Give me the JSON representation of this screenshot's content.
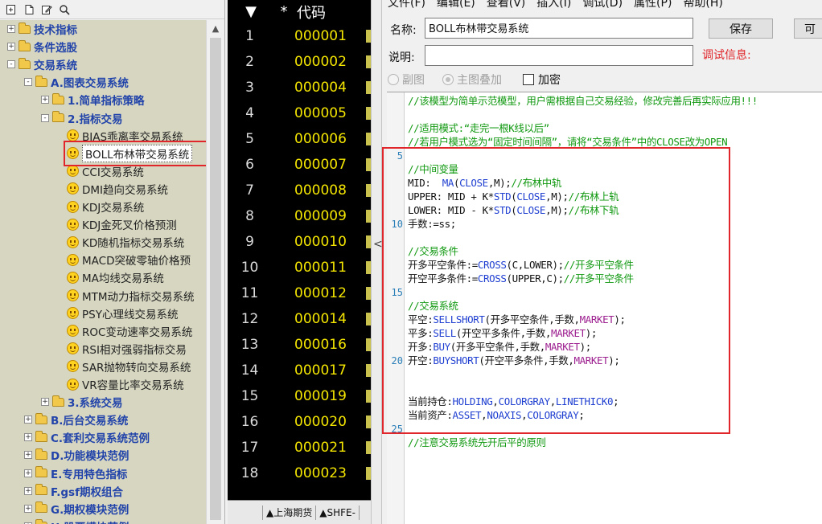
{
  "left_toolbar": {
    "icons": [
      "new-item-icon",
      "copy-icon",
      "edit-icon",
      "search-icon"
    ]
  },
  "tree": {
    "nodes": [
      {
        "label": "技术指标",
        "kind": "folder",
        "expander": "+"
      },
      {
        "label": "条件选股",
        "kind": "folder",
        "expander": "+"
      },
      {
        "label": "交易系统",
        "kind": "folder",
        "expander": "-"
      },
      {
        "label": "A.图表交易系统",
        "kind": "folder",
        "expander": "-"
      },
      {
        "label": "1.简单指标策略",
        "kind": "folder",
        "expander": "+"
      },
      {
        "label": "2.指标交易",
        "kind": "folder",
        "expander": "-"
      },
      {
        "label": "BIAS乖离率交易系统",
        "kind": "leaf"
      },
      {
        "label": "BOLL布林带交易系统",
        "kind": "leaf",
        "selected": true
      },
      {
        "label": "CCI交易系统",
        "kind": "leaf"
      },
      {
        "label": "DMI趋向交易系统",
        "kind": "leaf"
      },
      {
        "label": "KDJ交易系统",
        "kind": "leaf"
      },
      {
        "label": "KDJ金死叉价格预测",
        "kind": "leaf"
      },
      {
        "label": "KD随机指标交易系统",
        "kind": "leaf"
      },
      {
        "label": "MACD突破零轴价格预",
        "kind": "leaf"
      },
      {
        "label": "MA均线交易系统",
        "kind": "leaf"
      },
      {
        "label": "MTM动力指标交易系统",
        "kind": "leaf"
      },
      {
        "label": "PSY心理线交易系统",
        "kind": "leaf"
      },
      {
        "label": "ROC变动速率交易系统",
        "kind": "leaf"
      },
      {
        "label": "RSI相对强弱指标交易",
        "kind": "leaf"
      },
      {
        "label": "SAR抛物转向交易系统",
        "kind": "leaf"
      },
      {
        "label": "VR容量比率交易系统",
        "kind": "leaf"
      },
      {
        "label": "3.系统交易",
        "kind": "folder",
        "expander": "+"
      },
      {
        "label": "B.后台交易系统",
        "kind": "folder",
        "expander": "+"
      },
      {
        "label": "C.套利交易系统范例",
        "kind": "folder",
        "expander": "+"
      },
      {
        "label": "D.功能模块范例",
        "kind": "folder",
        "expander": "+"
      },
      {
        "label": "E.专用特色指标",
        "kind": "folder",
        "expander": "+"
      },
      {
        "label": "F.gsf期权组合",
        "kind": "folder",
        "expander": "+"
      },
      {
        "label": "G.期权模块范例",
        "kind": "folder",
        "expander": "+"
      },
      {
        "label": "H.股票模块范例",
        "kind": "folder",
        "expander": "+"
      }
    ]
  },
  "quotes": {
    "header": {
      "sort": "▼",
      "star": "*",
      "code": "代码"
    },
    "rows": [
      {
        "idx": "1",
        "code": "000001"
      },
      {
        "idx": "2",
        "code": "000002"
      },
      {
        "idx": "3",
        "code": "000004"
      },
      {
        "idx": "4",
        "code": "000005"
      },
      {
        "idx": "5",
        "code": "000006"
      },
      {
        "idx": "6",
        "code": "000007"
      },
      {
        "idx": "7",
        "code": "000008"
      },
      {
        "idx": "8",
        "code": "000009"
      },
      {
        "idx": "9",
        "code": "000010"
      },
      {
        "idx": "10",
        "code": "000011"
      },
      {
        "idx": "11",
        "code": "000012"
      },
      {
        "idx": "12",
        "code": "000014"
      },
      {
        "idx": "13",
        "code": "000016"
      },
      {
        "idx": "14",
        "code": "000017"
      },
      {
        "idx": "15",
        "code": "000019"
      },
      {
        "idx": "16",
        "code": "000020"
      },
      {
        "idx": "17",
        "code": "000021"
      },
      {
        "idx": "18",
        "code": "000023"
      }
    ],
    "tabs": [
      "▲上海期货",
      "▲SHFE-"
    ]
  },
  "splitter": {
    "arrow": "<"
  },
  "editor_window": {
    "menu": [
      "文件(F)",
      "编辑(E)",
      "查看(V)",
      "插入(I)",
      "调试(D)",
      "属性(P)",
      "帮助(H)"
    ],
    "name_label": "名称:",
    "name_value": "BOLL布林带交易系统",
    "desc_label": "说明:",
    "desc_value": "",
    "save_label": "保存",
    "other_button_label": "可",
    "debug_label": "调试信息:",
    "radio_sub": "副图",
    "radio_main": "主图叠加",
    "encrypt_label": "加密",
    "colors": {
      "comment": "#119911",
      "keyword": "#1f3fd1",
      "constant": "#9c1e8f",
      "highlight_box": "#e0262b"
    }
  },
  "code": {
    "line_numbers": [
      "5",
      "10",
      "15",
      "20",
      "25"
    ],
    "lines": [
      [
        [
          "c",
          "//该模型为简单示范模型，用户需根据自己交易经验，修改完善后再实际应用!!!"
        ]
      ],
      [],
      [
        [
          "c",
          "//适用模式:“走完一根K线以后”"
        ]
      ],
      [
        [
          "c",
          "//若用户模式选为“固定时间间隔”，请将“交易条件”中的CLOSE改为OPEN"
        ]
      ],
      [],
      [
        [
          "c",
          "//中间变量"
        ]
      ],
      [
        [
          "t",
          "MID:  "
        ],
        [
          "k",
          "MA"
        ],
        [
          "t",
          "("
        ],
        [
          "k",
          "CLOSE"
        ],
        [
          "t",
          ",M);"
        ],
        [
          "c",
          "//布林中轨"
        ]
      ],
      [
        [
          "t",
          "UPPER: MID + K*"
        ],
        [
          "k",
          "STD"
        ],
        [
          "t",
          "("
        ],
        [
          "k",
          "CLOSE"
        ],
        [
          "t",
          ",M);"
        ],
        [
          "c",
          "//布林上轨"
        ]
      ],
      [
        [
          "t",
          "LOWER: MID - K*"
        ],
        [
          "k",
          "STD"
        ],
        [
          "t",
          "("
        ],
        [
          "k",
          "CLOSE"
        ],
        [
          "t",
          ",M);"
        ],
        [
          "c",
          "//布林下轨"
        ]
      ],
      [
        [
          "t",
          "手数:=ss;"
        ]
      ],
      [],
      [
        [
          "c",
          "//交易条件"
        ]
      ],
      [
        [
          "t",
          "开多平空条件:="
        ],
        [
          "k",
          "CROSS"
        ],
        [
          "t",
          "(C,LOWER);"
        ],
        [
          "c",
          "//开多平空条件"
        ]
      ],
      [
        [
          "t",
          "开空平多条件:="
        ],
        [
          "k",
          "CROSS"
        ],
        [
          "t",
          "(UPPER,C);"
        ],
        [
          "c",
          "//开多平空条件"
        ]
      ],
      [],
      [
        [
          "c",
          "//交易系统"
        ]
      ],
      [
        [
          "t",
          "平空:"
        ],
        [
          "k",
          "SELLSHORT"
        ],
        [
          "t",
          "(开多平空条件,手数,"
        ],
        [
          "m",
          "MARKET"
        ],
        [
          "t",
          ");"
        ]
      ],
      [
        [
          "t",
          "平多:"
        ],
        [
          "k",
          "SELL"
        ],
        [
          "t",
          "(开空平多条件,手数,"
        ],
        [
          "m",
          "MARKET"
        ],
        [
          "t",
          ");"
        ]
      ],
      [
        [
          "t",
          "开多:"
        ],
        [
          "k",
          "BUY"
        ],
        [
          "t",
          "(开多平空条件,手数,"
        ],
        [
          "m",
          "MARKET"
        ],
        [
          "t",
          ");"
        ]
      ],
      [
        [
          "t",
          "开空:"
        ],
        [
          "k",
          "BUYSHORT"
        ],
        [
          "t",
          "(开空平多条件,手数,"
        ],
        [
          "m",
          "MARKET"
        ],
        [
          "t",
          ");"
        ]
      ],
      [],
      [],
      [
        [
          "t",
          "当前持仓:"
        ],
        [
          "k",
          "HOLDING"
        ],
        [
          "t",
          ","
        ],
        [
          "k",
          "COLORGRAY"
        ],
        [
          "t",
          ","
        ],
        [
          "k",
          "LINETHICK0"
        ],
        [
          "t",
          ";"
        ]
      ],
      [
        [
          "t",
          "当前资产:"
        ],
        [
          "k",
          "ASSET"
        ],
        [
          "t",
          ","
        ],
        [
          "k",
          "NOAXIS"
        ],
        [
          "t",
          ","
        ],
        [
          "k",
          "COLORGRAY"
        ],
        [
          "t",
          ";"
        ]
      ],
      [],
      [
        [
          "c",
          "//注意交易系统先开后平的原则"
        ]
      ]
    ]
  }
}
